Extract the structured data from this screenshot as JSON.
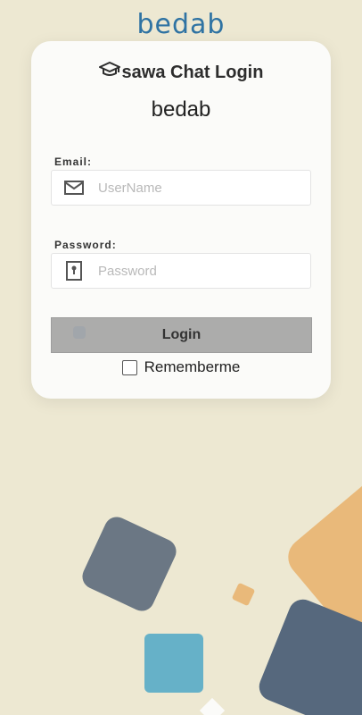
{
  "app": {
    "brand": "bedab"
  },
  "login": {
    "title": "sawa Chat Login",
    "subtitle": "bedab",
    "email_label": "Email:",
    "email_placeholder": "UserName",
    "password_label": "Password:",
    "password_placeholder": "Password",
    "login_button": "Login",
    "remember_label": "Rememberme"
  },
  "icons": {
    "title": "graduation-cap-icon",
    "email": "envelope-icon",
    "password": "keyhole-icon"
  },
  "colors": {
    "background": "#ede8d2",
    "brand": "#2f73a3",
    "button": "#acacab",
    "shape_slate": "#6b7784",
    "shape_navy": "#56687d",
    "shape_orange": "#e9b97a",
    "shape_teal": "#66b1c8"
  }
}
